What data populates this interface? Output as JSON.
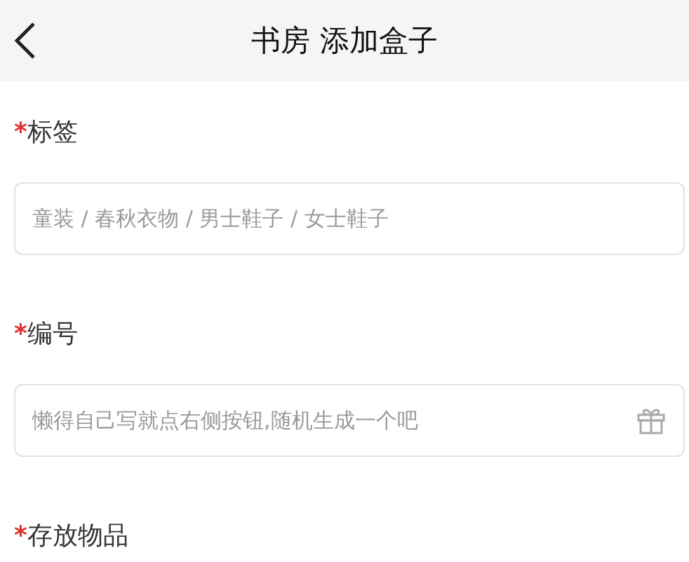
{
  "header": {
    "title": "书房 添加盒子"
  },
  "fields": [
    {
      "kind": "text",
      "label": "标签",
      "required_mark": "*",
      "placeholder": "童装 / 春秋衣物 / 男士鞋子 / 女士鞋子"
    },
    {
      "kind": "random",
      "label": "编号",
      "required_mark": "*",
      "placeholder": "懒得自己写就点右侧按钮,随机生成一个吧"
    },
    {
      "kind": "label",
      "label": "存放物品",
      "required_mark": "*"
    }
  ]
}
